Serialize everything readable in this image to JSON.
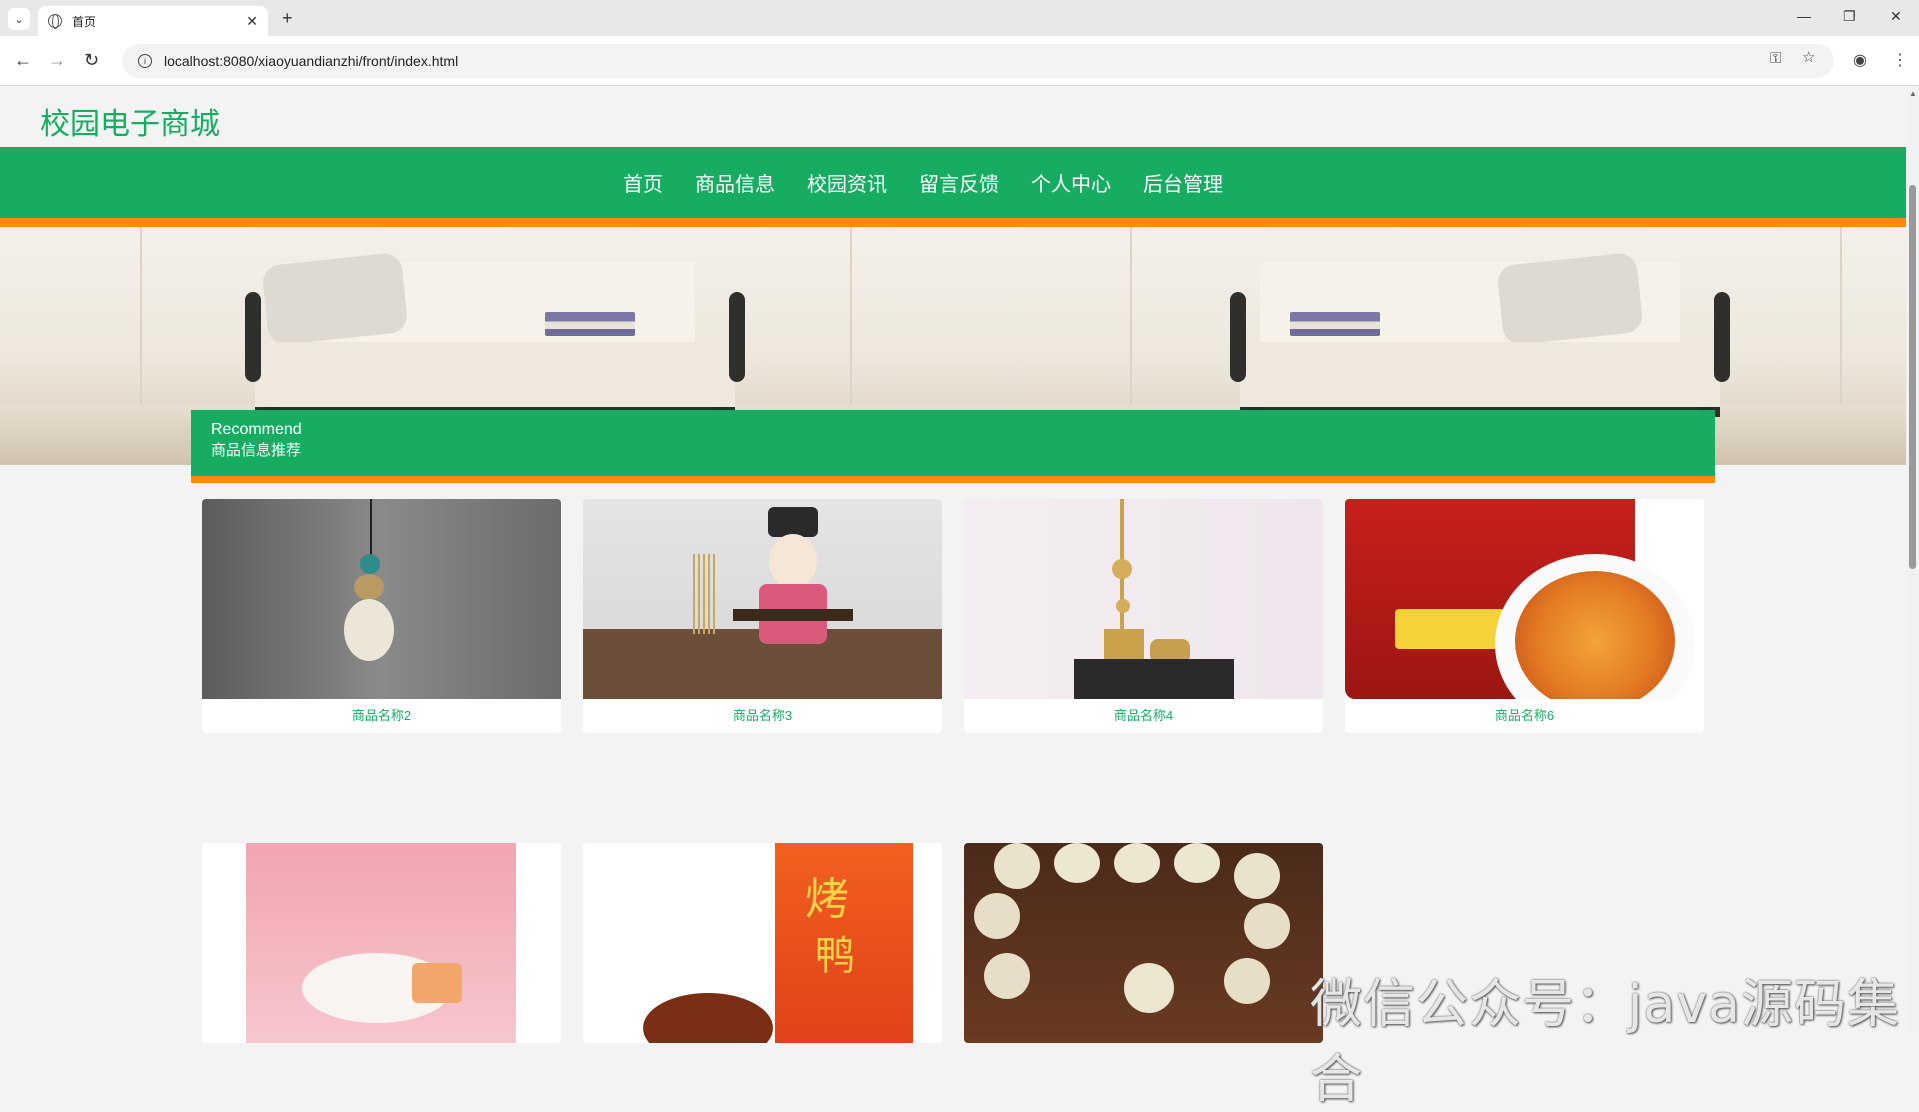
{
  "browser": {
    "tab_title": "首页",
    "url": "localhost:8080/xiaoyuandianzhi/front/index.html"
  },
  "site": {
    "title": "校园电子商城"
  },
  "nav": {
    "items": [
      {
        "label": "首页"
      },
      {
        "label": "商品信息"
      },
      {
        "label": "校园资讯"
      },
      {
        "label": "留言反馈"
      },
      {
        "label": "个人中心"
      },
      {
        "label": "后台管理"
      }
    ]
  },
  "recommend": {
    "en": "Recommend",
    "cn": "商品信息推荐"
  },
  "products": [
    {
      "name": "商品名称2"
    },
    {
      "name": "商品名称3"
    },
    {
      "name": "商品名称4"
    },
    {
      "name": "商品名称6"
    }
  ],
  "watermark": "微信公众号：java源码集合",
  "colors": {
    "brand_green": "#16ac62",
    "accent_orange": "#ff8a00"
  }
}
